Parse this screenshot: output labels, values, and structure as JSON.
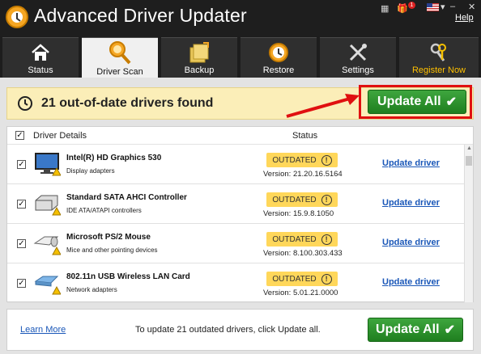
{
  "app": {
    "title": "Advanced Driver Updater",
    "help_label": "Help",
    "notif_count": "1"
  },
  "tabs": [
    {
      "label": "Status",
      "icon": "home-icon"
    },
    {
      "label": "Driver Scan",
      "icon": "magnifier-icon"
    },
    {
      "label": "Backup",
      "icon": "backup-icon"
    },
    {
      "label": "Restore",
      "icon": "clock-restore-icon"
    },
    {
      "label": "Settings",
      "icon": "tools-icon"
    },
    {
      "label": "Register Now",
      "icon": "keys-icon"
    }
  ],
  "banner": {
    "message": "21 out-of-date drivers found",
    "button_label": "Update All"
  },
  "table": {
    "col_driver": "Driver Details",
    "col_status": "Status",
    "rows": [
      {
        "name": "Intel(R) HD Graphics 530",
        "category": "Display adapters",
        "status": "OUTDATED",
        "version": "Version: 21.20.16.5164",
        "action": "Update driver",
        "icon": "monitor-icon"
      },
      {
        "name": "Standard SATA AHCI Controller",
        "category": "IDE ATA/ATAPI controllers",
        "status": "OUTDATED",
        "version": "Version: 15.9.8.1050",
        "action": "Update driver",
        "icon": "drive-icon"
      },
      {
        "name": "Microsoft PS/2 Mouse",
        "category": "Mice and other pointing devices",
        "status": "OUTDATED",
        "version": "Version: 8.100.303.433",
        "action": "Update driver",
        "icon": "keyboard-mouse-icon"
      },
      {
        "name": "802.11n USB Wireless LAN Card",
        "category": "Network adapters",
        "status": "OUTDATED",
        "version": "Version: 5.01.21.0000",
        "action": "Update driver",
        "icon": "network-card-icon"
      }
    ]
  },
  "footer": {
    "learn_more": "Learn More",
    "message": "To update 21 outdated drivers, click Update all.",
    "button_label": "Update All"
  },
  "colors": {
    "accent_green": "#2e962e",
    "highlight_red": "#e01010",
    "banner_yellow": "#fbeeb8",
    "badge_yellow": "#ffd75a",
    "link_blue": "#1a57b8"
  }
}
